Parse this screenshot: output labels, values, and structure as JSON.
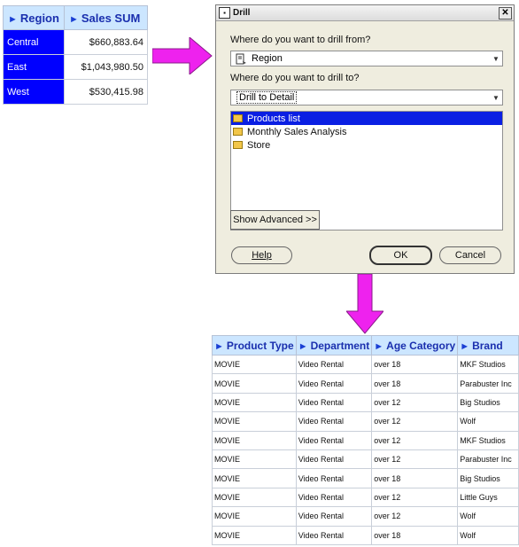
{
  "source_table": {
    "headers": [
      "Region",
      "Sales SUM"
    ],
    "rows": [
      {
        "region": "Central",
        "sales": "$660,883.64"
      },
      {
        "region": "East",
        "sales": "$1,043,980.50"
      },
      {
        "region": "West",
        "sales": "$530,415.98"
      }
    ]
  },
  "dialog": {
    "title": "Drill",
    "close_glyph": "✕",
    "from_label": "Where do you want to drill from?",
    "from_value": "Region",
    "to_label": "Where do you want to drill to?",
    "to_value": "Drill to Detail",
    "items": [
      "Products list",
      "Monthly Sales Analysis",
      "Store"
    ],
    "show_advanced": "Show Advanced >>",
    "help": "Help",
    "ok": "OK",
    "cancel": "Cancel"
  },
  "result_table": {
    "headers": [
      "Product Type",
      "Department",
      "Age Category",
      "Brand"
    ],
    "rows": [
      [
        "MOVIE",
        "Video Rental",
        "over 18",
        "MKF Studios"
      ],
      [
        "MOVIE",
        "Video Rental",
        "over 18",
        "Parabuster Inc"
      ],
      [
        "MOVIE",
        "Video Rental",
        "over 12",
        "Big Studios"
      ],
      [
        "MOVIE",
        "Video Rental",
        "over 12",
        "Wolf"
      ],
      [
        "MOVIE",
        "Video Rental",
        "over 12",
        "MKF Studios"
      ],
      [
        "MOVIE",
        "Video Rental",
        "over 12",
        "Parabuster Inc"
      ],
      [
        "MOVIE",
        "Video Rental",
        "over 18",
        "Big Studios"
      ],
      [
        "MOVIE",
        "Video Rental",
        "over 12",
        "Little Guys"
      ],
      [
        "MOVIE",
        "Video Rental",
        "over 12",
        "Wolf"
      ],
      [
        "MOVIE",
        "Video Rental",
        "over 18",
        "Wolf"
      ]
    ]
  },
  "colors": {
    "header_bg": "#cce6ff",
    "header_text": "#1a2fae",
    "region_cell": "#0000ff",
    "arrow": "#ee22ee",
    "selection": "#0a1fe3"
  }
}
